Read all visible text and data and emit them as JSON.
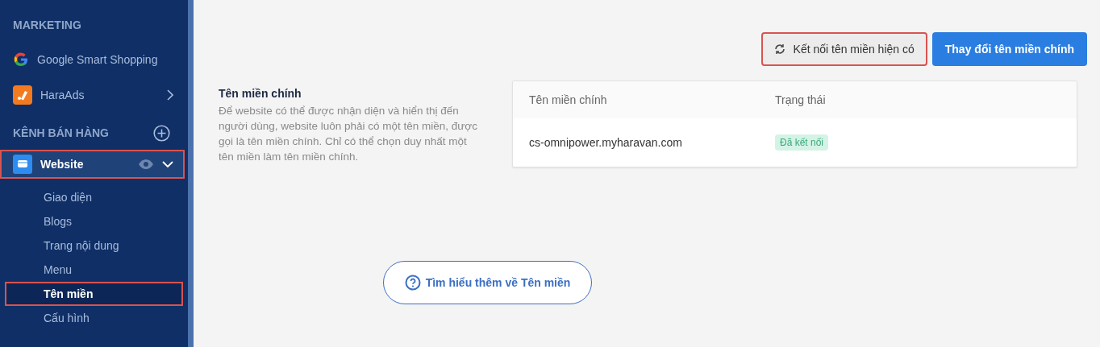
{
  "sidebar": {
    "sections": [
      {
        "title": "MARKETING",
        "kind": "plain",
        "items": [
          {
            "label": "Google Smart Shopping",
            "kind": "link",
            "highlighted": false,
            "selected": false
          },
          {
            "label": "HaraAds",
            "kind": "submenu",
            "highlighted": false,
            "selected": false
          }
        ]
      },
      {
        "title": "KÊNH BÁN HÀNG",
        "kind": "addable",
        "items": [
          {
            "label": "Website",
            "kind": "channel",
            "highlighted": true,
            "selected": true,
            "children": [
              {
                "label": "Giao diện",
                "selected": false,
                "highlighted": false
              },
              {
                "label": "Blogs",
                "selected": false,
                "highlighted": false
              },
              {
                "label": "Trang nội dung",
                "selected": false,
                "highlighted": false
              },
              {
                "label": "Menu",
                "selected": false,
                "highlighted": false
              },
              {
                "label": "Tên miền",
                "selected": true,
                "highlighted": true
              },
              {
                "label": "Cấu hình",
                "selected": false,
                "highlighted": false
              }
            ]
          }
        ]
      }
    ]
  },
  "actions": [
    {
      "label": "Kết nối tên miền hiện có",
      "kind": "secondary",
      "highlighted": true
    },
    {
      "label": "Thay đổi tên miền chính",
      "kind": "primary",
      "highlighted": false
    }
  ],
  "section": {
    "title": "Tên miền chính",
    "description": "Để website có thể được nhận diện và hiển thị đến người dùng, website luôn phải có một tên miền, được gọi là tên miền chính. Chỉ có thể chọn duy nhất một tên miền làm tên miền chính."
  },
  "table": {
    "columns": [
      "Tên miền chính",
      "Trạng thái"
    ],
    "rows": [
      {
        "domain": "cs-omnipower.myharavan.com",
        "status": "Đã kết nối",
        "color": "#d4f3e6"
      }
    ]
  },
  "help_link": {
    "label": "Tìm hiểu thêm về Tên miền"
  }
}
